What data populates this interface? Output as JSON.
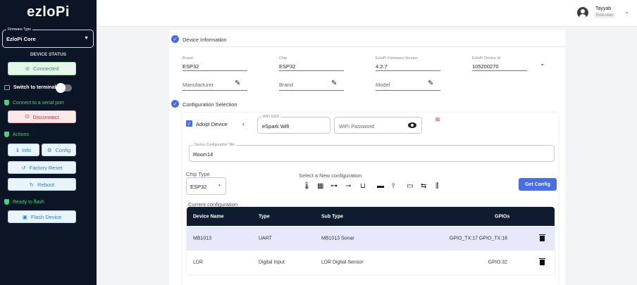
{
  "app": {
    "logo": "ezloPi"
  },
  "sidebar": {
    "firmware_type_label": "Firmware Type",
    "firmware_type_value": "EzloPi Core",
    "device_status_title": "DEVICE STATUS",
    "connected_label": "Connected",
    "switch_terminal_label": "Switch to terminal",
    "connect_serial_label": "Connect to a serial port",
    "disconnect_label": "Disconnect",
    "actions_label": "Actions",
    "info_label": "Info",
    "config_label": "Config",
    "factory_reset_label": "Factory Reset",
    "reboot_label": "Reboot",
    "ready_flash_label": "Ready to flash",
    "flash_device_label": "Flash Device"
  },
  "header": {
    "user_name": "Tayyab",
    "user_role": "End-user"
  },
  "device_info": {
    "title": "Device Information",
    "board_label": "Board",
    "board_value": "ESP32",
    "chip_label": "Chip",
    "chip_value": "ESP32",
    "firmware_label": "EzloPi Firmware Version",
    "firmware_value": "4.2.7",
    "device_id_label": "EzloPi Device Id",
    "device_id_value": "105200270",
    "manufacturer_placeholder": "Manufacturer",
    "brand_placeholder": "Brand",
    "model_placeholder": "Model"
  },
  "config_selection": {
    "title": "Configuration Selection",
    "adopt_device_label": "Adopt Device",
    "wifi_ssid_label": "WiFi SSID",
    "wifi_ssid_value": "eSpark Wifi",
    "wifi_password_placeholder": "WiFi Password",
    "device_config_title_label": "Device Configuration Title",
    "device_config_title_value": "Room14",
    "chip_type_label": "Chip Type",
    "chip_type_value": "ESP32",
    "select_new_config_label": "Select a New configuration",
    "sensor_icons": [
      "temperature-sensor",
      "relay-module",
      "servo-motor",
      "potentiometer",
      "ultrasonic-sensor",
      "ir-sensor",
      "antenna-sensor",
      "display-module",
      "switch-module",
      "connector-module"
    ],
    "get_config_label": "Get Config",
    "current_config_label": "Current configuration"
  },
  "table": {
    "headers": {
      "device_name": "Device Name",
      "type": "Type",
      "sub_type": "Sub Type",
      "gpios": "GPIOs"
    },
    "rows": [
      {
        "device_name": "MB1013",
        "type": "UART",
        "sub_type": "MB1013 Sonar",
        "gpios": "GPIO_TX:17 GPIO_TX:16"
      },
      {
        "device_name": "LDR",
        "type": "Digital Input",
        "sub_type": "LDR Digtial Sensor",
        "gpios": "GPIO:32"
      }
    ]
  },
  "colors": {
    "sidebar_bg": "#0c1526",
    "accent": "#4a6ee0",
    "success": "#4cd07d",
    "danger": "#d2303b"
  }
}
